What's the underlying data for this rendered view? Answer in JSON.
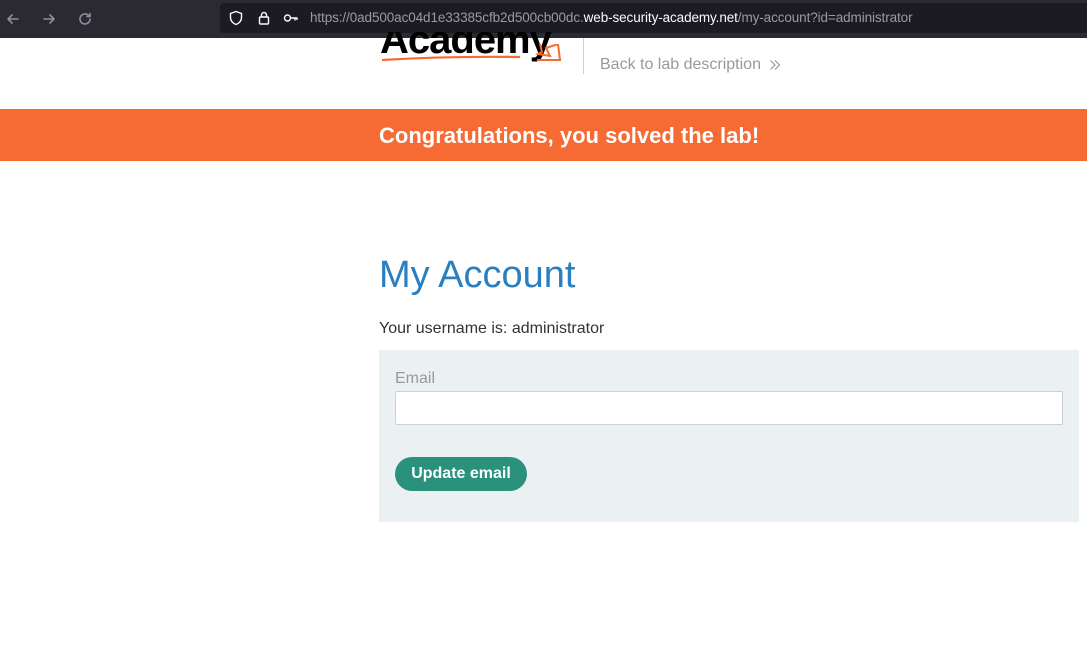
{
  "browser": {
    "url_prefix": "https://0ad500ac04d1e33385cfb2d500cb00dc.",
    "url_host": "web-security-academy.net",
    "url_path": "/my-account?id=administrator"
  },
  "header": {
    "logo_text": "Academy",
    "back_link": "Back to lab description"
  },
  "banner": {
    "text": "Congratulations, you solved the lab!"
  },
  "main": {
    "title": "My Account",
    "username_line": "Your username is: administrator",
    "form": {
      "email_label": "Email",
      "email_value": "",
      "button_label": "Update email"
    }
  },
  "colors": {
    "banner": "#f66a33",
    "title": "#2a7fc0",
    "button": "#2a917d",
    "panel": "#ebf0f2"
  },
  "icons": [
    "back-arrow-icon",
    "forward-arrow-icon",
    "reload-icon",
    "shield-icon",
    "lock-icon",
    "key-icon",
    "double-chevron-right-icon"
  ]
}
